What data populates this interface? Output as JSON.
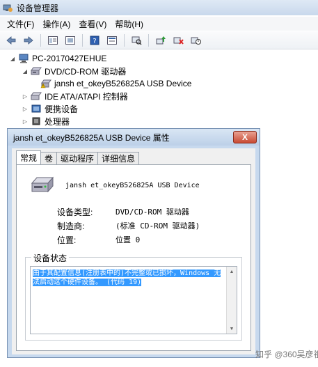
{
  "window": {
    "title": "设备管理器"
  },
  "menu": [
    "文件(F)",
    "操作(A)",
    "查看(V)",
    "帮助(H)"
  ],
  "toolbar": {
    "buttons": [
      "back-arrow-icon",
      "forward-arrow-icon",
      "show-hide-icon",
      "properties-icon",
      "help-icon",
      "view-icon",
      "scan-icon",
      "update-driver-icon",
      "disable-icon",
      "uninstall-icon"
    ]
  },
  "tree": {
    "root": "PC-20170427EHUE",
    "items": [
      {
        "label": "DVD/CD-ROM 驱动器"
      },
      {
        "label": "jansh et_okeyB526825A USB Device"
      },
      {
        "label": "IDE ATA/ATAPI 控制器"
      },
      {
        "label": "便携设备"
      },
      {
        "label": "处理器"
      }
    ]
  },
  "dialog": {
    "title": "jansh et_okeyB526825A USB Device 属性",
    "close_label": "X",
    "tabs": [
      "常规",
      "卷",
      "驱动程序",
      "详细信息"
    ],
    "device_name": "jansh et_okeyB526825A USB Device",
    "props": [
      {
        "label": "设备类型:",
        "value": "DVD/CD-ROM 驱动器"
      },
      {
        "label": "制造商:",
        "value": "(标准 CD-ROM 驱动器)"
      },
      {
        "label": "位置:",
        "value": "位置 0"
      }
    ],
    "status_title": "设备状态",
    "status_line1": "由于其配置信息(注册表中的)不完整或已损坏，Windows 无",
    "status_line2": "法启动这个硬件设备。 (代码 19)"
  },
  "watermark": {
    "text": "知乎 @360吴彦祖"
  }
}
